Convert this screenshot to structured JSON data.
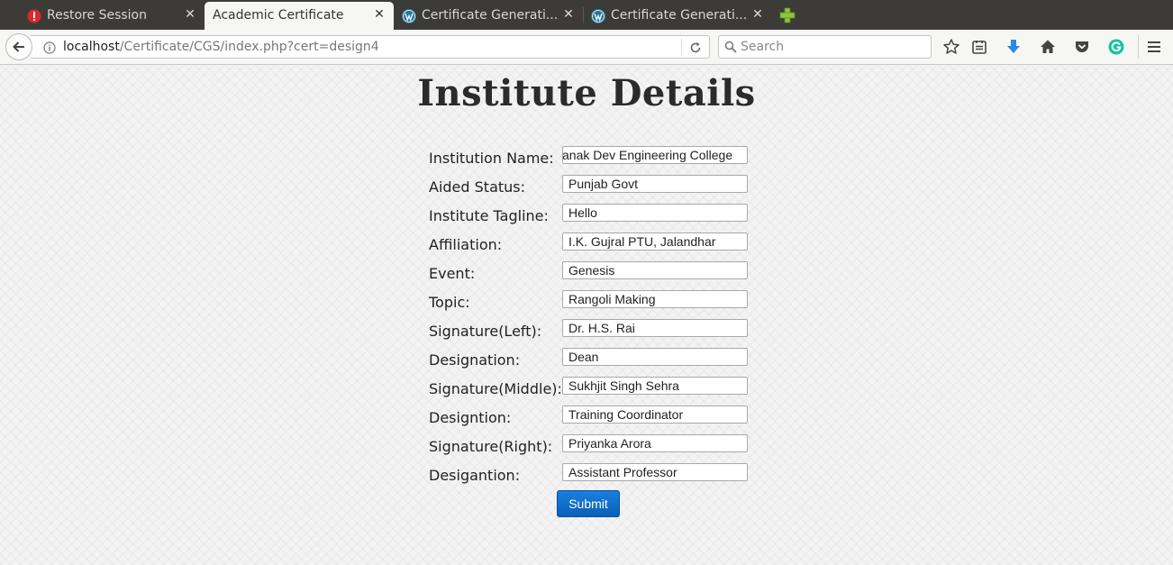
{
  "browser": {
    "tabs": [
      {
        "label": "Restore Session",
        "icon": "error-icon"
      },
      {
        "label": "Academic Certificate",
        "icon": "none",
        "active": true
      },
      {
        "label": "Certificate Generati...",
        "icon": "wordpress-icon"
      },
      {
        "label": "Certificate Generati...",
        "icon": "wordpress-icon"
      }
    ],
    "url": {
      "host": "localhost",
      "path": "/Certificate/CGS/index.php?cert=design4"
    },
    "search": {
      "placeholder": "Search"
    }
  },
  "page": {
    "title": "Institute Details",
    "fields": [
      {
        "label": "Institution Name:",
        "value": "anak Dev Engineering College"
      },
      {
        "label": "Aided Status:",
        "value": "Punjab Govt"
      },
      {
        "label": "Institute Tagline:",
        "value": "Hello"
      },
      {
        "label": "Affiliation:",
        "value": "I.K. Gujral PTU, Jalandhar"
      },
      {
        "label": "Event:",
        "value": "Genesis"
      },
      {
        "label": "Topic:",
        "value": "Rangoli Making"
      },
      {
        "label": "Signature(Left):",
        "value": "Dr. H.S. Rai"
      },
      {
        "label": "Designation:",
        "value": "Dean"
      },
      {
        "label": "Signature(Middle):",
        "value": "Sukhjit Singh Sehra"
      },
      {
        "label": "Designtion:",
        "value": "Training Coordinator"
      },
      {
        "label": "Signature(Right):",
        "value": "Priyanka Arora"
      },
      {
        "label": "Desigantion:",
        "value": "Assistant Professor"
      }
    ],
    "submit_label": "Submit"
  },
  "colors": {
    "tabstrip_bg": "#3c3b37",
    "submit_bg": "#0a6ad0",
    "error_red": "#e0262b",
    "download_blue": "#2a8ae6",
    "grammarly_green": "#15c39a"
  }
}
